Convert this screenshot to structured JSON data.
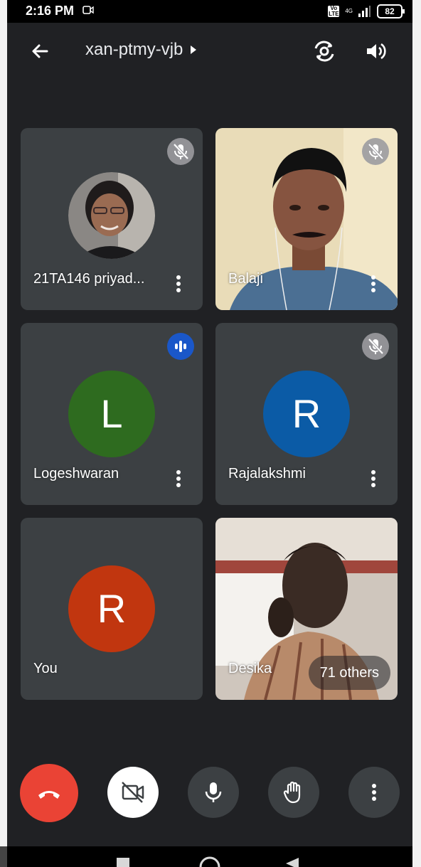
{
  "status_bar": {
    "time": "2:16 PM",
    "volte": "Vo LTE",
    "network": "4G",
    "battery": "82"
  },
  "header": {
    "meeting_code": "xan-ptmy-vjb"
  },
  "participants": [
    {
      "name": "21TA146 priyad...",
      "state": "muted",
      "view": "photo-avatar"
    },
    {
      "name": "Balaji",
      "state": "muted",
      "view": "video"
    },
    {
      "name": "Logeshwaran",
      "initial": "L",
      "avatar_color": "#2e6b1f",
      "state": "speaking",
      "view": "initial"
    },
    {
      "name": "Rajalakshmi",
      "initial": "R",
      "avatar_color": "#0b5ba6",
      "state": "muted",
      "view": "initial"
    },
    {
      "name": "You",
      "initial": "R",
      "avatar_color": "#c1360f",
      "state": "none",
      "view": "initial"
    },
    {
      "name": "Desika",
      "others_label": "71 others",
      "view": "video"
    }
  ],
  "controls": {
    "end_call_color": "#ea4335",
    "camera_off_bg": "#ffffff",
    "control_bg": "#3c4043"
  }
}
